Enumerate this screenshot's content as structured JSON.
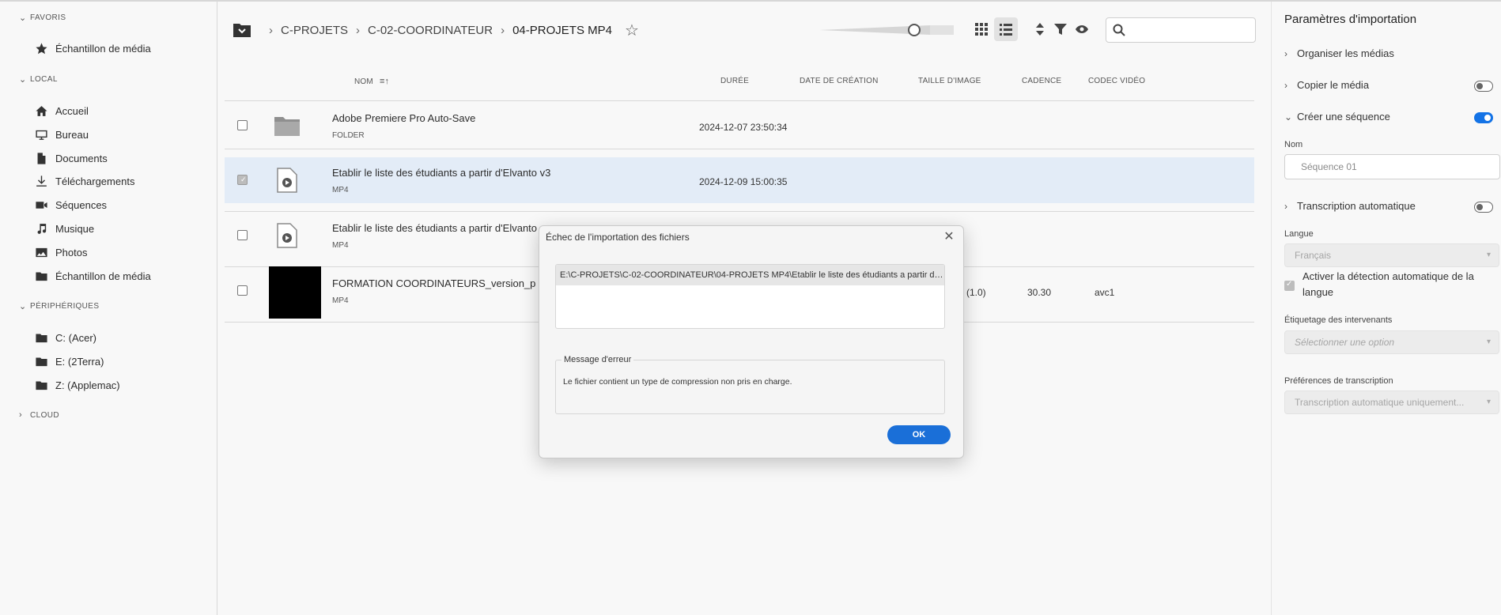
{
  "sidebar": {
    "favoris_title": "FAVORIS",
    "favoris_items": [
      {
        "label": "Échantillon de média",
        "icon": "star-icon"
      }
    ],
    "local_title": "LOCAL",
    "local_items": [
      {
        "label": "Accueil",
        "icon": "home-icon"
      },
      {
        "label": "Bureau",
        "icon": "desktop-icon"
      },
      {
        "label": "Documents",
        "icon": "document-icon"
      },
      {
        "label": "Téléchargements",
        "icon": "download-icon"
      },
      {
        "label": "Séquences",
        "icon": "video-camera-icon"
      },
      {
        "label": "Musique",
        "icon": "music-icon"
      },
      {
        "label": "Photos",
        "icon": "photo-icon"
      },
      {
        "label": "Échantillon de média",
        "icon": "folder-icon"
      }
    ],
    "devices_title": "PÉRIPHÉRIQUES",
    "devices_items": [
      {
        "label": "C: (Acer)",
        "icon": "folder-icon"
      },
      {
        "label": "E: (2Terra)",
        "icon": "folder-icon"
      },
      {
        "label": "Z: (Applemac)",
        "icon": "folder-icon"
      }
    ],
    "cloud_title": "CLOUD"
  },
  "breadcrumb": {
    "items": [
      "C-PROJETS",
      "C-02-COORDINATEUR",
      "04-PROJETS MP4"
    ]
  },
  "search": {
    "placeholder": ""
  },
  "columns": {
    "name": "NOM",
    "duration": "DURÉE",
    "created": "DATE DE CRÉATION",
    "frame_size": "TAILLE D'IMAGE",
    "frame_rate": "CADENCE",
    "codec": "CODEC VIDÉO"
  },
  "rows": [
    {
      "name": "Adobe Premiere Pro Auto-Save",
      "type": "FOLDER",
      "date": "2024-12-07 23:50:34",
      "frame_size": "",
      "frame_rate": "",
      "codec": ""
    },
    {
      "name": "Etablir le liste des étudiants a partir d'Elvanto v3",
      "type": "MP4",
      "date": "2024-12-09 15:00:35",
      "frame_size": "",
      "frame_rate": "",
      "codec": ""
    },
    {
      "name": "Etablir le liste des étudiants a partir d'Elvanto",
      "type": "MP4",
      "date": "",
      "frame_size": "",
      "frame_rate": "",
      "codec": ""
    },
    {
      "name": "FORMATION COORDINATEURS_version_p",
      "type": "MP4",
      "date": "",
      "frame_size": "(1.0)",
      "frame_rate": "30.30",
      "codec": "avc1"
    }
  ],
  "right_panel": {
    "title": "Paramètres d'importation",
    "organize": "Organiser les médias",
    "copy": "Copier le média",
    "create_sequence": "Créer une séquence",
    "name_label": "Nom",
    "name_placeholder": "Séquence 01",
    "auto_transcription": "Transcription automatique",
    "language_label": "Langue",
    "language_value": "Français",
    "auto_detect": "Activer la détection automatique de la langue",
    "speaker_label": "Étiquetage des intervenants",
    "speaker_value": "Sélectionner une option",
    "prefs_label": "Préférences de transcription",
    "prefs_value": "Transcription automatique uniquement..."
  },
  "dialog": {
    "title": "Échec de l'importation des fichiers",
    "file_path": "E:\\C-PROJETS\\C-02-COORDINATEUR\\04-PROJETS MP4\\Etablir le liste des étudiants a partir d'Elvant...",
    "error_legend": "Message d'erreur",
    "error_message": "Le fichier contient un type de compression non pris en charge.",
    "ok_label": "OK"
  },
  "colors": {
    "accent": "#1473e6",
    "selected_row": "#e3ecf7"
  }
}
